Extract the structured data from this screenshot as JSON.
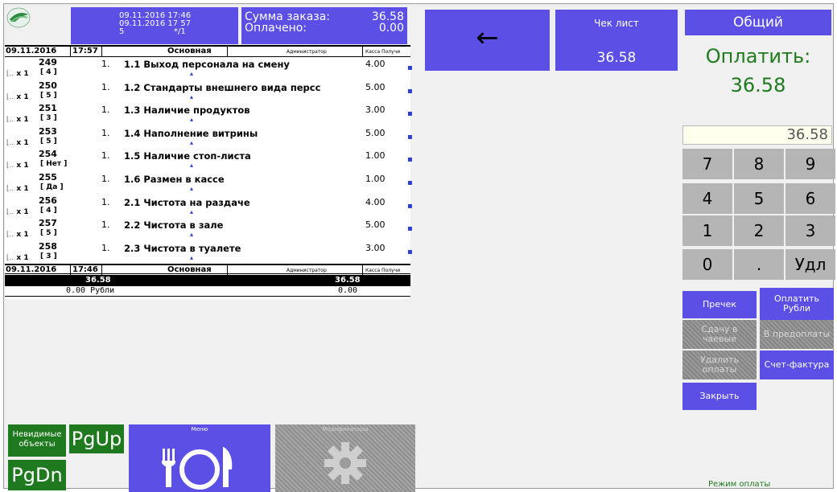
{
  "header": {
    "date_lines": [
      "09.11.2016 17:46",
      "09.11.2016 17 57"
    ],
    "date_line3_a": "5",
    "date_line3_b": "*/1",
    "sum_label": "Сумма заказа:",
    "sum_value": "36.58",
    "paid_label": "Оплачено:",
    "paid_value": "0.00"
  },
  "list": {
    "top_header": {
      "date": "09.11.2016",
      "time": "17:57",
      "section": "Основная",
      "role": "Администратор",
      "till": "Касса Получи"
    },
    "items": [
      {
        "code": "249",
        "qty": "1.",
        "name": "1.1 Выход персонала на смену",
        "price": "4.00",
        "mult": "x 1",
        "mod": "[ 4 ]"
      },
      {
        "code": "250",
        "qty": "1.",
        "name": "1.2 Стандарты внешнего вида персс",
        "price": "5.00",
        "mult": "x 1",
        "mod": "[ 5 ]"
      },
      {
        "code": "251",
        "qty": "1.",
        "name": "1.3 Наличие продуктов",
        "price": "3.00",
        "mult": "x 1",
        "mod": "[ 3 ]"
      },
      {
        "code": "253",
        "qty": "1.",
        "name": "1.4 Наполнение витрины",
        "price": "5.00",
        "mult": "x 1",
        "mod": "[ 5 ]"
      },
      {
        "code": "254",
        "qty": "1.",
        "name": "1.5 Наличие стоп-листа",
        "price": "1.00",
        "mult": "x 1",
        "mod": "[ Нет ]"
      },
      {
        "code": "255",
        "qty": "1.",
        "name": "1.6 Размен в кассе",
        "price": "1.00",
        "mult": "x 1",
        "mod": "[ Да ]"
      },
      {
        "code": "256",
        "qty": "1.",
        "name": "2.1 Чистота на раздаче",
        "price": "4.00",
        "mult": "x 1",
        "mod": "[ 4 ]"
      },
      {
        "code": "257",
        "qty": "1.",
        "name": "2.2 Чистота в зале",
        "price": "5.00",
        "mult": "x 1",
        "mod": "[ 5 ]"
      },
      {
        "code": "258",
        "qty": "1.",
        "name": "2.3 Чистота в туалете",
        "price": "3.00",
        "mult": "x 1",
        "mod": "[ 3 ]"
      }
    ],
    "bottom_header": {
      "date": "09.11.2016",
      "time": "17:46",
      "section": "Основная",
      "role": "Администратор",
      "till": "Касса Получи"
    },
    "total_left": "36.58",
    "total_right": "36.58",
    "paid_left": "0.00 Рубли",
    "paid_right": "0.00"
  },
  "bottom_buttons": {
    "invisible_objects": "Невидимые объекты",
    "pgup": "PgUp",
    "pgdn": "PgDn",
    "menu": "Меню",
    "modifiers": "Модификаторы"
  },
  "right": {
    "back_arrow": "←",
    "cheque_label": "Чек лист",
    "cheque_value": "36.58",
    "general": "Общий",
    "pay_title": "Оплатить:",
    "pay_amount": "36.58",
    "amount_input": "36.58",
    "keys": [
      "7",
      "8",
      "9",
      "4",
      "5",
      "6",
      "1",
      "2",
      "3",
      "0",
      ".",
      "Удл"
    ],
    "actions": {
      "precheck": "Пречек",
      "pay_rub": "Оплатить Рубли",
      "change_tips": "Сдачу в чаевые",
      "prepay": "В предоплаты",
      "delete_pay": "Удалить оплаты",
      "invoice": "Счет-фактура",
      "close": "Закрыть"
    },
    "mode": "Режим оплаты"
  },
  "colors": {
    "accent": "#5b4fe6",
    "green": "#1f7a1f",
    "key": "#b5b5b5",
    "disabled": "#8f8f8f"
  }
}
